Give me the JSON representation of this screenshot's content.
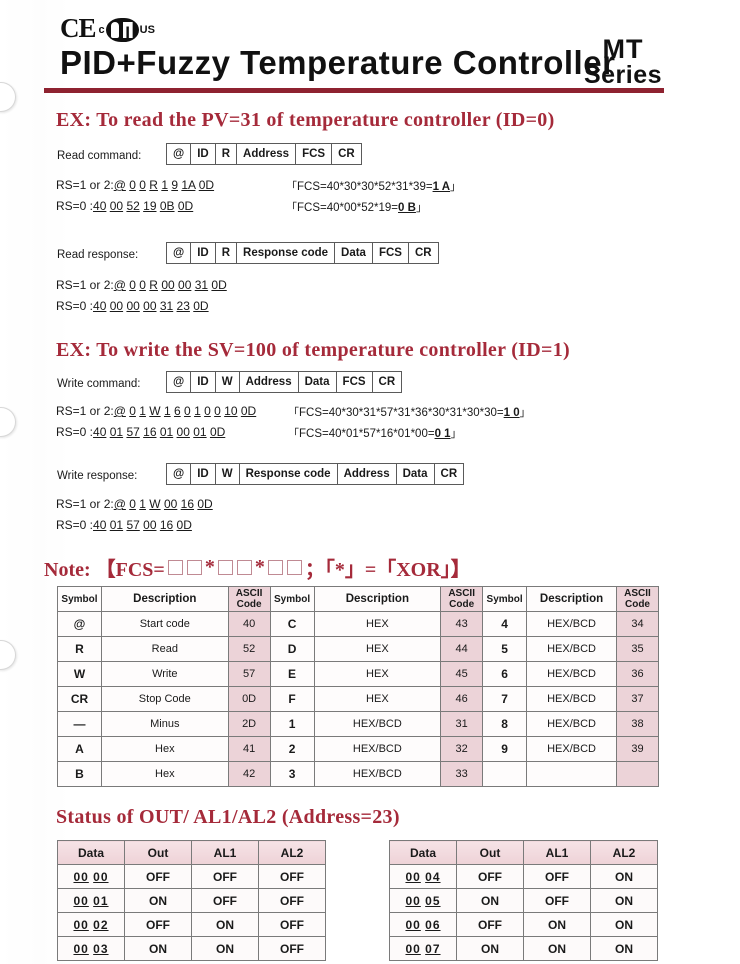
{
  "header": {
    "ce_mark": "CE",
    "ul_c": "c",
    "ul_us": "US",
    "title": "PID+Fuzzy  Temperature  Controller",
    "series_top": "MT",
    "series_bottom": "Series"
  },
  "sections": {
    "read": {
      "heading": "EX:  To  read  the  PV=31  of  temperature  controller  (ID=0)",
      "command": {
        "label": "Read command:",
        "cells": [
          "@",
          "ID",
          "R",
          "Address",
          "FCS",
          "CR"
        ]
      },
      "command_rs1": "RS=1  or  2:@  0  0  R  1  9  1A  0D",
      "command_rs0": "RS=0  :40  00  52  19  0B  0D",
      "command_fcs1_pre": "FCS=40*30*30*52*31*39=",
      "command_fcs1_bold": "1  A",
      "command_fcs0_pre": "FCS=40*00*52*19=",
      "command_fcs0_bold": "0  B",
      "response": {
        "label": "Read response:",
        "cells": [
          "@",
          "ID",
          "R",
          "Response code",
          "Data",
          "FCS",
          "CR"
        ]
      },
      "response_rs1": "RS=1  or  2:@  0  0  R  00  00  31  0D",
      "response_rs0": "RS=0  :40  00  00  00  31  23  0D"
    },
    "write": {
      "heading": "EX:  To  write  the  SV=100  of  temperature  controller  (ID=1)",
      "command": {
        "label": "Write command:",
        "cells": [
          "@",
          "ID",
          "W",
          "Address",
          "Data",
          "FCS",
          "CR"
        ]
      },
      "command_rs1": "RS=1  or  2:@  0  1  W  1  6  0  1  0  0  10  0D",
      "command_rs0": "RS=0  :40  01  57  16  01  00  01  0D",
      "command_fcs1_pre": "FCS=40*30*31*57*31*36*30*31*30*30=",
      "command_fcs1_bold": "1  0",
      "command_fcs0_pre": "FCS=40*01*57*16*01*00=",
      "command_fcs0_bold": "0  1",
      "response": {
        "label": "Write response:",
        "cells": [
          "@",
          "ID",
          "W",
          "Response code",
          "Address",
          "Data",
          "CR"
        ]
      },
      "response_rs1": "RS=1  or  2:@  0  1  W  00  16  0D",
      "response_rs0": "RS=0  :40  01  57  00  16  0D"
    }
  },
  "note": {
    "prefix": "Note: 【FCS=",
    "star1": "*",
    "star2": "*",
    "suffix": "；「*」=「XOR」】"
  },
  "symbol_table": {
    "headers": [
      "Symbol",
      "Description",
      "ASCII Code",
      "Symbol",
      "Description",
      "ASCII Code",
      "Symbol",
      "Description",
      "ASCII Code"
    ],
    "rows": [
      [
        "@",
        "Start code",
        "40",
        "C",
        "HEX",
        "43",
        "4",
        "HEX/BCD",
        "34"
      ],
      [
        "R",
        "Read",
        "52",
        "D",
        "HEX",
        "44",
        "5",
        "HEX/BCD",
        "35"
      ],
      [
        "W",
        "Write",
        "57",
        "E",
        "HEX",
        "45",
        "6",
        "HEX/BCD",
        "36"
      ],
      [
        "CR",
        "Stop Code",
        "0D",
        "F",
        "HEX",
        "46",
        "7",
        "HEX/BCD",
        "37"
      ],
      [
        "—",
        "Minus",
        "2D",
        "1",
        "HEX/BCD",
        "31",
        "8",
        "HEX/BCD",
        "38"
      ],
      [
        "A",
        "Hex",
        "41",
        "2",
        "HEX/BCD",
        "32",
        "9",
        "HEX/BCD",
        "39"
      ],
      [
        "B",
        "Hex",
        "42",
        "3",
        "HEX/BCD",
        "33",
        "",
        "",
        ""
      ]
    ]
  },
  "status": {
    "heading": "Status of OUT/  AL1/AL2  (Address=23)",
    "headers": [
      "Data",
      "Out",
      "AL1",
      "AL2"
    ],
    "left_rows": [
      [
        "00",
        "00",
        "OFF",
        "OFF",
        "OFF"
      ],
      [
        "00",
        "01",
        "ON",
        "OFF",
        "OFF"
      ],
      [
        "00",
        "02",
        "OFF",
        "ON",
        "OFF"
      ],
      [
        "00",
        "03",
        "ON",
        "ON",
        "OFF"
      ]
    ],
    "right_rows": [
      [
        "00",
        "04",
        "OFF",
        "OFF",
        "ON"
      ],
      [
        "00",
        "05",
        "ON",
        "OFF",
        "ON"
      ],
      [
        "00",
        "06",
        "OFF",
        "ON",
        "ON"
      ],
      [
        "00",
        "07",
        "ON",
        "ON",
        "ON"
      ]
    ]
  },
  "colors": {
    "accent": "#a52a3a",
    "rule": "#8e2230",
    "pink": "#ecd3d8"
  }
}
